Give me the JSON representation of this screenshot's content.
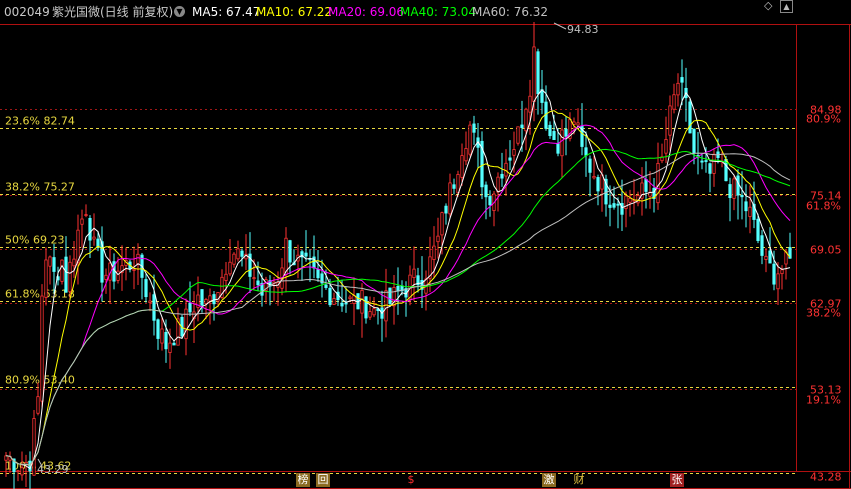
{
  "header": {
    "code": "002049",
    "name": "紫光国微",
    "period": "(日线 前复权)",
    "dropdown_icon": "dropdown-circle-icon",
    "ma5": {
      "label": "MA5: 67.47",
      "color": "#ffffff"
    },
    "ma10": {
      "label": "MA10: 67.22",
      "color": "#ffff00"
    },
    "ma20": {
      "label": "MA20: 69.06",
      "color": "#ff00ff"
    },
    "ma40": {
      "label": "MA40: 73.04",
      "color": "#00ff00"
    },
    "ma60": {
      "label": "MA60: 76.32",
      "color": "#c0c0c0"
    }
  },
  "toolbar": {
    "diamond_icon": "diamond-icon",
    "collapse_icon": "collapse-arrow-icon"
  },
  "fib_levels": [
    {
      "pct": "23.6%",
      "value": "82.74"
    },
    {
      "pct": "38.2%",
      "value": "75.27"
    },
    {
      "pct": "50%",
      "value": "69.23"
    },
    {
      "pct": "61.8%",
      "value": "63.18"
    },
    {
      "pct": "80.9%",
      "value": "53.40"
    },
    {
      "pct": "100%",
      "value": "43.62"
    }
  ],
  "annotations": {
    "high": "94.83",
    "low": "43.29"
  },
  "y_axis_prices": [
    "84.98",
    "75.14",
    "69.05",
    "62.97",
    "53.13",
    "43.28"
  ],
  "y_axis_pcts": [
    "80.9%",
    "61.8%",
    "38.2%",
    "19.1%"
  ],
  "events": [
    "榜",
    "回",
    "$",
    "激",
    "财",
    "张"
  ],
  "colors": {
    "up": "#ff3232",
    "down": "#54ffff",
    "fib": "#e8d840",
    "background": "#000000"
  },
  "chart_data": {
    "type": "candlestick",
    "ylim": [
      43.28,
      94.83
    ],
    "high": 94.83,
    "low": 43.29,
    "price_ticks": [
      84.98,
      75.14,
      69.05,
      62.97,
      53.13,
      43.28
    ],
    "pct_ticks": [
      80.9,
      61.8,
      38.2,
      19.1
    ],
    "fib_retracement": [
      {
        "pct": 23.6,
        "value": 82.74
      },
      {
        "pct": 38.2,
        "value": 75.27
      },
      {
        "pct": 50,
        "value": 69.23
      },
      {
        "pct": 61.8,
        "value": 63.18
      },
      {
        "pct": 80.9,
        "value": 53.4
      },
      {
        "pct": 100,
        "value": 43.62
      }
    ],
    "close_path": [
      [
        0,
        45.6
      ],
      [
        2,
        45.0
      ],
      [
        4,
        44.4
      ],
      [
        6,
        45.2
      ],
      [
        8,
        52
      ],
      [
        9,
        64
      ],
      [
        10,
        68.5
      ],
      [
        12,
        66
      ],
      [
        14,
        67.8
      ],
      [
        15,
        65
      ],
      [
        16,
        67
      ],
      [
        18,
        71
      ],
      [
        20,
        74
      ],
      [
        22,
        69
      ],
      [
        24,
        66.5
      ],
      [
        26,
        66
      ],
      [
        28,
        66.8
      ],
      [
        30,
        67.2
      ],
      [
        32,
        67.8
      ],
      [
        34,
        66
      ],
      [
        36,
        63
      ],
      [
        38,
        60
      ],
      [
        40,
        58.2
      ],
      [
        42,
        59.5
      ],
      [
        44,
        60
      ],
      [
        46,
        62
      ],
      [
        48,
        63.5
      ],
      [
        50,
        62.5
      ],
      [
        52,
        64
      ],
      [
        54,
        66
      ],
      [
        56,
        69
      ],
      [
        58,
        68.5
      ],
      [
        60,
        67
      ],
      [
        62,
        66
      ],
      [
        64,
        64
      ],
      [
        66,
        65
      ],
      [
        68,
        66
      ],
      [
        70,
        69.5
      ],
      [
        72,
        68
      ],
      [
        74,
        67
      ],
      [
        76,
        66.5
      ],
      [
        78,
        65
      ],
      [
        80,
        64.5
      ],
      [
        82,
        64
      ],
      [
        84,
        63.5
      ],
      [
        86,
        63
      ],
      [
        88,
        63
      ],
      [
        90,
        62.8
      ],
      [
        92,
        62
      ],
      [
        94,
        62.5
      ],
      [
        96,
        63
      ],
      [
        98,
        64
      ],
      [
        100,
        64.8
      ],
      [
        102,
        65.5
      ],
      [
        104,
        66
      ],
      [
        106,
        67.5
      ],
      [
        108,
        70
      ],
      [
        110,
        74
      ],
      [
        112,
        77
      ],
      [
        114,
        81
      ],
      [
        116,
        83
      ],
      [
        118,
        79.5
      ],
      [
        120,
        75
      ],
      [
        122,
        76
      ],
      [
        124,
        78.5
      ],
      [
        126,
        80
      ],
      [
        128,
        82
      ],
      [
        130,
        86
      ],
      [
        132,
        90
      ],
      [
        134,
        86
      ],
      [
        136,
        82
      ],
      [
        138,
        81.5
      ],
      [
        140,
        82
      ],
      [
        142,
        84
      ],
      [
        144,
        80
      ],
      [
        146,
        78.5
      ],
      [
        148,
        77
      ],
      [
        150,
        75.5
      ],
      [
        152,
        74.8
      ],
      [
        154,
        74.5
      ],
      [
        156,
        75
      ],
      [
        158,
        75
      ],
      [
        160,
        75.5
      ],
      [
        162,
        76
      ],
      [
        164,
        79
      ],
      [
        166,
        84
      ],
      [
        168,
        88
      ],
      [
        170,
        85
      ],
      [
        172,
        80
      ],
      [
        174,
        78
      ],
      [
        176,
        77.5
      ],
      [
        178,
        79
      ],
      [
        180,
        77
      ],
      [
        182,
        75.5
      ],
      [
        184,
        74.5
      ],
      [
        186,
        73
      ],
      [
        188,
        70
      ],
      [
        190,
        67
      ],
      [
        192,
        66.5
      ],
      [
        194,
        66.8
      ],
      [
        196,
        67.5
      ]
    ],
    "series": [
      {
        "name": "MA5",
        "values_last": 67.47
      },
      {
        "name": "MA10",
        "values_last": 67.22
      },
      {
        "name": "MA20",
        "values_last": 69.06
      },
      {
        "name": "MA40",
        "values_last": 73.04
      },
      {
        "name": "MA60",
        "values_last": 76.32
      }
    ]
  }
}
